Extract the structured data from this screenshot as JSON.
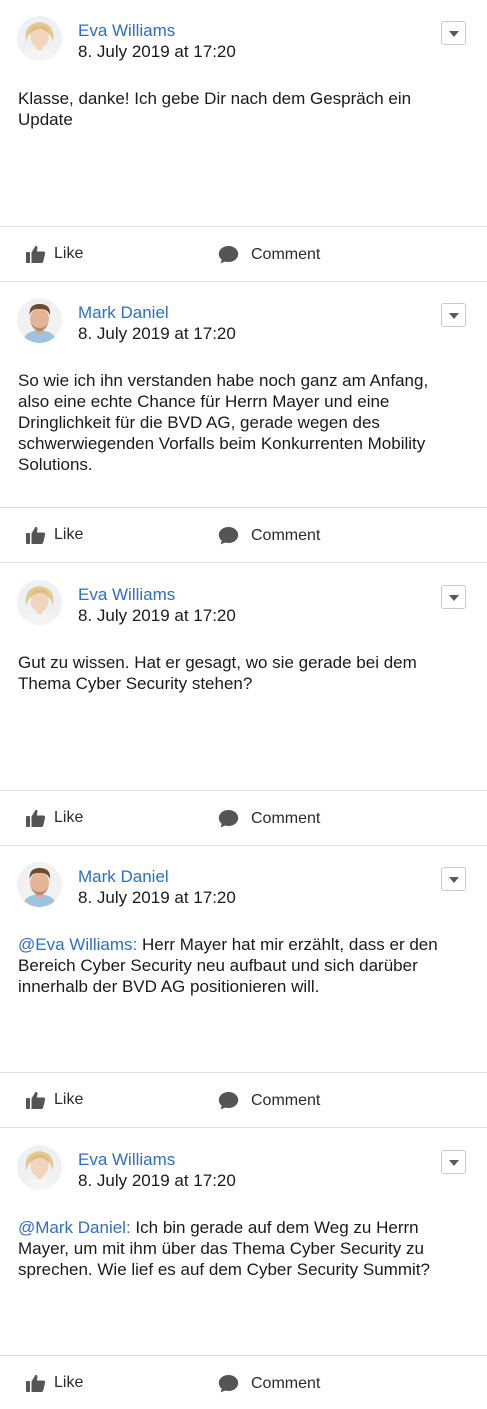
{
  "feed": {
    "posts": [
      {
        "author": "Eva Williams",
        "timestamp": "8. July 2019 at 17:20",
        "mention": "",
        "text": "Klasse, danke! Ich gebe Dir nach dem Gespräch ein Update",
        "like_label": "Like",
        "comment_label": "Comment"
      },
      {
        "author": "Mark Daniel",
        "timestamp": "8. July 2019 at 17:20",
        "mention": "",
        "text": "So wie ich ihn verstanden habe noch ganz am Anfang, also eine echte Chance für Herrn Mayer und eine Dringlichkeit für die BVD AG, gerade wegen des schwerwiegenden Vorfalls beim Konkurrenten Mobility Solutions.",
        "like_label": "Like",
        "comment_label": "Comment"
      },
      {
        "author": "Eva Williams",
        "timestamp": "8. July 2019 at 17:20",
        "mention": "",
        "text": "Gut zu wissen. Hat er gesagt, wo sie gerade bei dem Thema Cyber Security stehen?",
        "like_label": "Like",
        "comment_label": "Comment"
      },
      {
        "author": "Mark Daniel",
        "timestamp": "8. July 2019 at 17:20",
        "mention": "@Eva Williams:",
        "text": "Herr Mayer hat mir erzählt, dass er den Bereich Cyber Security neu aufbaut und sich darüber innerhalb der BVD AG positionieren will.",
        "like_label": "Like",
        "comment_label": "Comment"
      },
      {
        "author": "Eva Williams",
        "timestamp": "8. July 2019 at 17:20",
        "mention": "@Mark Daniel:",
        "text": "Ich bin gerade auf dem Weg zu Herrn Mayer, um mit ihm über das Thema Cyber Security zu sprechen. Wie lief es auf dem Cyber Security Summit?",
        "like_label": "Like",
        "comment_label": "Comment"
      }
    ]
  },
  "icons": {
    "like": "thumbs-up-icon",
    "comment": "speech-bubble-icon",
    "menu": "chevron-down-icon"
  },
  "colors": {
    "link": "#2e6fc4",
    "text": "#1a1a1a",
    "divider": "#dcdcdc",
    "icon": "#555555"
  }
}
